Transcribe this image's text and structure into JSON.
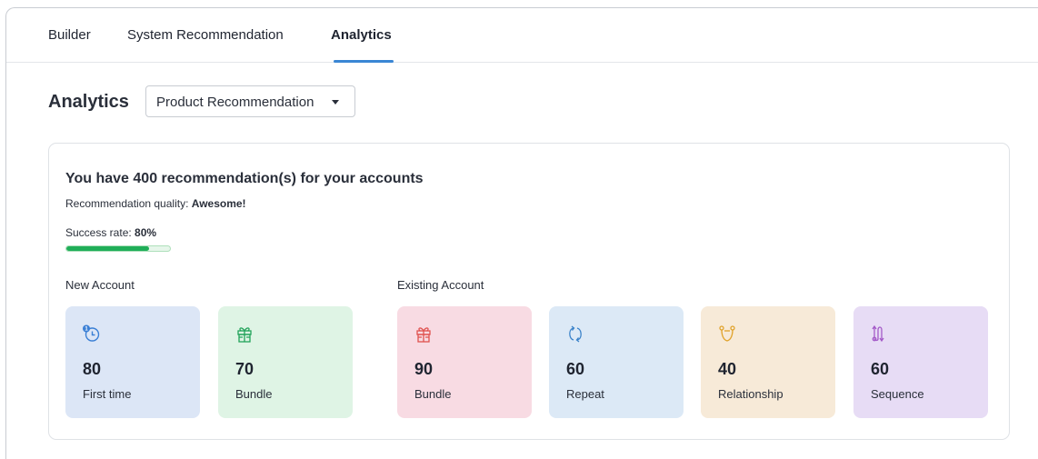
{
  "tabs": [
    {
      "label": "Builder",
      "active": false
    },
    {
      "label": "System Recommendation",
      "active": false
    },
    {
      "label": "Analytics",
      "active": true
    }
  ],
  "header": {
    "title": "Analytics",
    "dropdown": {
      "selected": "Product Recommendation"
    }
  },
  "summary": {
    "headline": "You have 400 recommendation(s) for your accounts",
    "quality_label": "Recommendation quality:",
    "quality_value": "Awesome!",
    "success_label": "Success rate:",
    "success_value": "80%",
    "success_fraction": 0.8
  },
  "groups": {
    "new": "New Account",
    "existing": "Existing Account"
  },
  "cards": [
    {
      "value": "80",
      "label": "First time",
      "icon": "clock-first-icon",
      "bg": "#dce6f6",
      "color": "#3a7fd5"
    },
    {
      "value": "70",
      "label": "Bundle",
      "icon": "gift-icon",
      "bg": "#dff4e5",
      "color": "#22a35a"
    },
    {
      "value": "90",
      "label": "Bundle",
      "icon": "gift-icon",
      "bg": "#f8dbe3",
      "color": "#e0524f"
    },
    {
      "value": "60",
      "label": "Repeat",
      "icon": "repeat-icon",
      "bg": "#dce9f6",
      "color": "#3a82c9"
    },
    {
      "value": "40",
      "label": "Relationship",
      "icon": "relationship-icon",
      "bg": "#f7ead8",
      "color": "#e0a22a"
    },
    {
      "value": "60",
      "label": "Sequence",
      "icon": "sequence-icon",
      "bg": "#e7dcf5",
      "color": "#a45ac8"
    }
  ]
}
